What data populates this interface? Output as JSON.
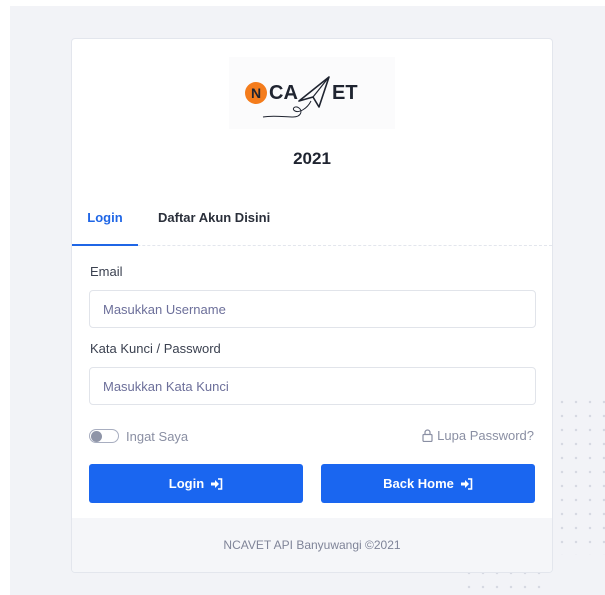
{
  "brand": {
    "logo_text": "NCAVET",
    "year": "2021"
  },
  "tabs": [
    {
      "label": "Login",
      "active": true
    },
    {
      "label": "Daftar Akun Disini",
      "active": false
    }
  ],
  "form": {
    "email_label": "Email",
    "email_placeholder": "Masukkan Username",
    "email_value": "",
    "password_label": "Kata Kunci / Password",
    "password_placeholder": "Masukkan Kata Kunci",
    "password_value": "",
    "remember_label": "Ingat Saya",
    "remember_checked": false,
    "forgot_label": "Lupa Password?"
  },
  "buttons": {
    "login_label": "Login",
    "home_label": "Back Home"
  },
  "footer": {
    "text": "NCAVET API Banyuwangi ©2021"
  },
  "colors": {
    "primary": "#1a66f0",
    "accent_orange": "#f47c1c",
    "text_dark": "#1f2430"
  },
  "icons": [
    "logo-n-circle",
    "paper-plane-icon",
    "lock-icon",
    "sign-in-icon"
  ]
}
